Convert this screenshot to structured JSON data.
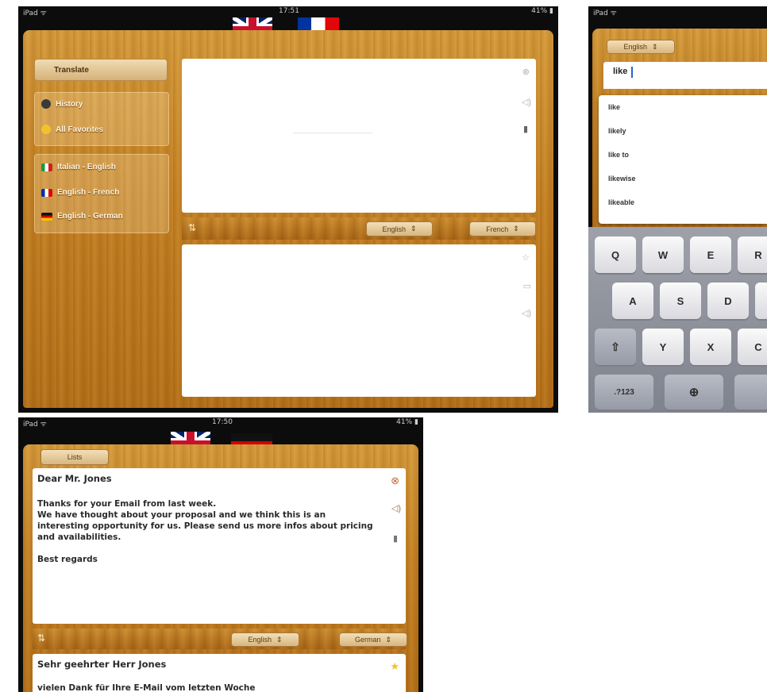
{
  "screen1": {
    "status_left": "iPad ᯤ",
    "status_time": "17:51",
    "status_right": "41% ▮",
    "translate_button": "Translate",
    "history_label": "History",
    "favorites_label": "All Favorites",
    "pairs": [
      "Italian - English",
      "English - French",
      "English - German"
    ],
    "swap_label": "⇅",
    "source_lang": "English",
    "target_lang": "French",
    "placeholder_hint": "‒‒‒‒‒‒‒‒‒‒‒‒‒‒‒‒‒‒‒‒"
  },
  "screen2": {
    "status_left": "iPad ᯤ",
    "lang_select": "English",
    "input_value": "like",
    "suggestions": [
      "like",
      "likely",
      "like to",
      "likewise",
      "likeable"
    ],
    "keys_row1": [
      "Q",
      "W",
      "E",
      "R"
    ],
    "keys_row2": [
      "A",
      "S",
      "D"
    ],
    "keys_row3": [
      "Y",
      "X",
      "C"
    ],
    "key_shift": "⇧",
    "key_numbers": ".?123",
    "key_globe": "⊕"
  },
  "screen3": {
    "status_left": "iPad ᯤ",
    "status_time": "17:50",
    "status_right": "41% ▮",
    "tab_label": "Lists",
    "source_lines": [
      "Dear Mr. Jones",
      "",
      "Thanks for your Email from last week.",
      "We have thought about your proposal and we think this is an",
      "interesting opportunity for us. Please send us more infos about pricing",
      "and availabilities.",
      "",
      "Best regards"
    ],
    "swap_label": "⇅",
    "source_lang": "English",
    "target_lang": "German",
    "output_lines": [
      "Sehr geehrter Herr Jones",
      "vielen Dank für Ihre E-Mail vom letzten Woche"
    ]
  },
  "colors": {
    "wood": "#c27f22",
    "bezel": "#0c0c0c",
    "accent_star": "#f2c12e"
  }
}
